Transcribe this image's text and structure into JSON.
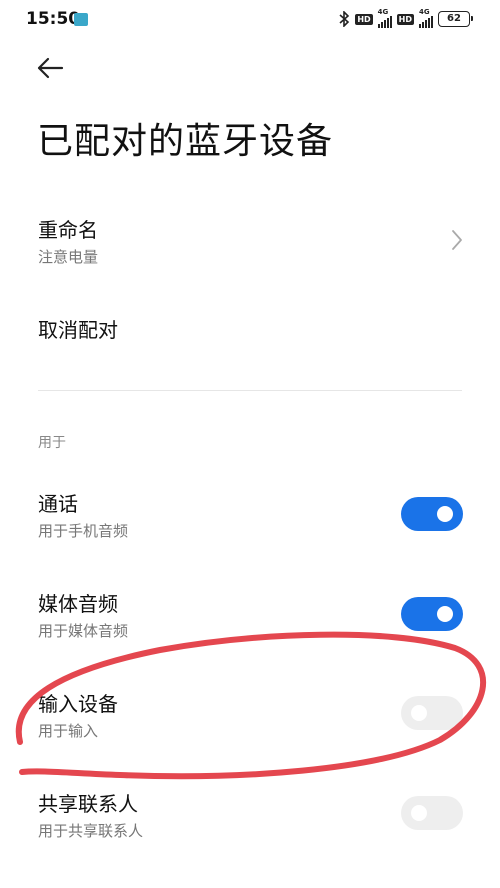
{
  "status_bar": {
    "time": "15:50",
    "app_badge": "BOSS直聘",
    "bluetooth_icon": "bluetooth-icon",
    "sim1": {
      "hd": "HD",
      "network": "4G"
    },
    "sim2": {
      "hd": "HD",
      "network": "4G"
    },
    "battery": "62"
  },
  "header": {
    "back_icon": "arrow-left-icon",
    "title": "已配对的蓝牙设备"
  },
  "settings": {
    "rename": {
      "title": "重命名",
      "subtitle": "注意电量"
    },
    "unpair": {
      "title": "取消配对"
    }
  },
  "usage": {
    "section_label": "用于",
    "items": [
      {
        "title": "通话",
        "subtitle": "用于手机音频",
        "enabled": true
      },
      {
        "title": "媒体音频",
        "subtitle": "用于媒体音频",
        "enabled": true
      },
      {
        "title": "输入设备",
        "subtitle": "用于输入",
        "enabled": false
      },
      {
        "title": "共享联系人",
        "subtitle": "用于共享联系人",
        "enabled": false
      }
    ]
  },
  "colors": {
    "toggle_on": "#1a73e8",
    "toggle_off": "#eeeeee",
    "annotation_stroke": "#e4474f"
  }
}
